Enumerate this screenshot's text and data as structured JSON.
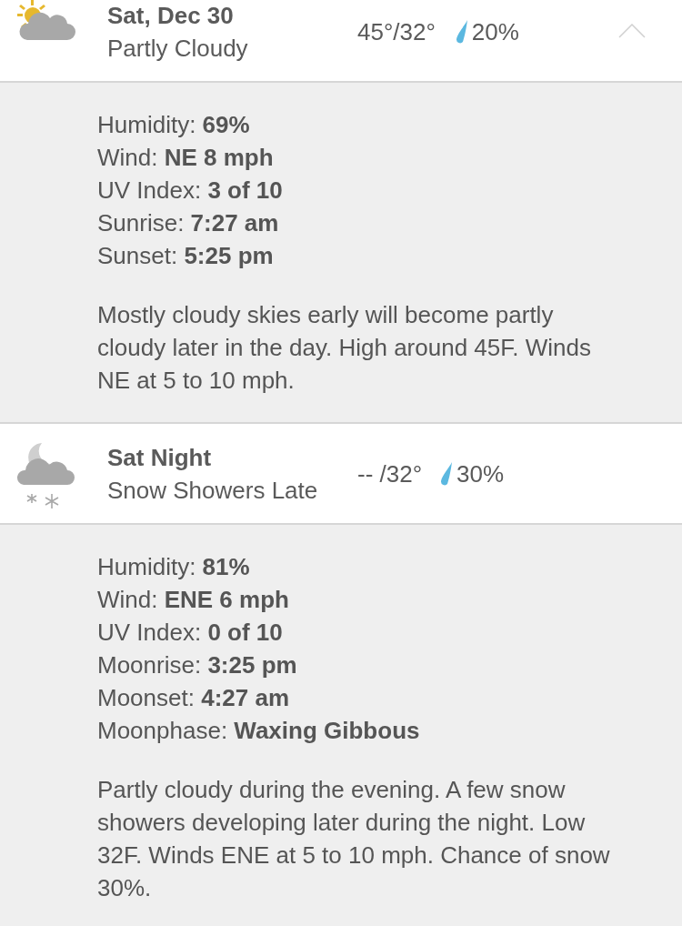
{
  "periods": [
    {
      "kind": "partly-cloudy-day",
      "title": "Sat, Dec 30",
      "condition": "Partly Cloudy",
      "temps": "45°/32°",
      "precip": "20%",
      "caret_shown": true,
      "details": [
        {
          "label": "Humidity:",
          "value": "69%"
        },
        {
          "label": "Wind:",
          "value": "NE 8 mph"
        },
        {
          "label": "UV Index:",
          "value": "3 of 10"
        },
        {
          "label": "Sunrise:",
          "value": "7:27 am"
        },
        {
          "label": "Sunset:",
          "value": "5:25 pm"
        }
      ],
      "narrative": "Mostly cloudy skies early will become partly cloudy later in the day. High around 45F. Winds NE at 5 to 10 mph."
    },
    {
      "kind": "night-snow",
      "title": "Sat Night",
      "condition": "Snow Showers Late",
      "temps": "-- /32°",
      "precip": "30%",
      "details": [
        {
          "label": "Humidity:",
          "value": "81%"
        },
        {
          "label": "Wind:",
          "value": "ENE 6 mph"
        },
        {
          "label": "UV Index:",
          "value": "0 of 10"
        },
        {
          "label": "Moonrise:",
          "value": "3:25 pm"
        },
        {
          "label": "Moonset:",
          "value": "4:27 am"
        },
        {
          "label": "Moonphase:",
          "value": "Waxing Gibbous"
        }
      ],
      "narrative": "Partly cloudy during the evening. A few snow showers developing later during the night. Low 32F. Winds ENE at 5 to 10 mph. Chance of snow 30%."
    }
  ]
}
